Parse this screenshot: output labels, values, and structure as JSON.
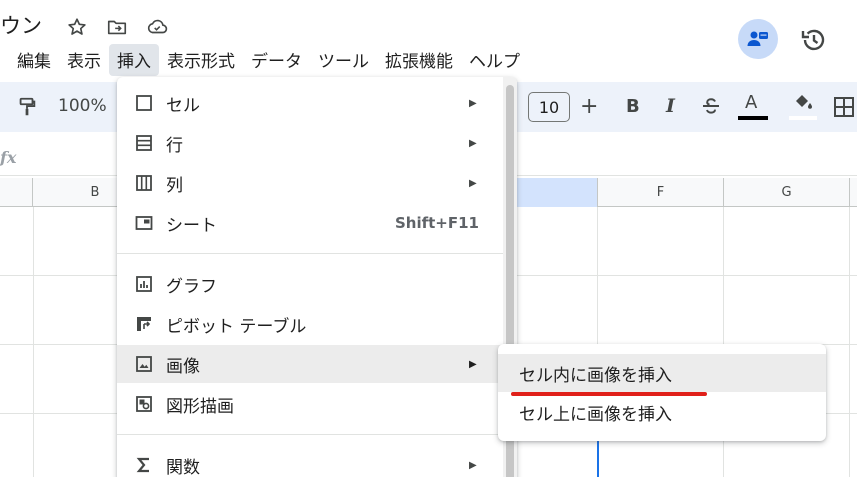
{
  "document": {
    "title": "ウン"
  },
  "menubar": {
    "items": [
      {
        "label": "編集"
      },
      {
        "label": "表示"
      },
      {
        "label": "挿入"
      },
      {
        "label": "表示形式"
      },
      {
        "label": "データ"
      },
      {
        "label": "ツール"
      },
      {
        "label": "拡張機能"
      },
      {
        "label": "ヘルプ"
      }
    ],
    "active_index": 2
  },
  "toolbar": {
    "zoom": "100%",
    "font_size": "10",
    "icons": [
      "paint-format-icon",
      "plus-icon",
      "bold-icon",
      "italic-icon",
      "strikethrough-icon",
      "text-color-icon",
      "fill-color-icon",
      "borders-icon"
    ],
    "bold_label": "B",
    "italic_label": "I",
    "text_color_label": "A",
    "text_color": "#000000",
    "fill_color": "#ffffff",
    "plus_label": "+"
  },
  "formula_bar": {
    "fx_label": "fx"
  },
  "grid": {
    "column_headers": [
      "B",
      "F",
      "G"
    ],
    "selected_column_color": "#d3e3fd"
  },
  "insert_menu": {
    "items": [
      {
        "label": "セル",
        "icon": "cell-icon",
        "has_submenu": true
      },
      {
        "label": "行",
        "icon": "rows-icon",
        "has_submenu": true
      },
      {
        "label": "列",
        "icon": "columns-icon",
        "has_submenu": true
      },
      {
        "label": "シート",
        "icon": "sheet-icon",
        "shortcut": "Shift+F11"
      },
      {
        "label": "グラフ",
        "icon": "chart-icon"
      },
      {
        "label": "ピボット テーブル",
        "icon": "pivot-table-icon"
      },
      {
        "label": "画像",
        "icon": "image-icon",
        "has_submenu": true,
        "highlighted": true
      },
      {
        "label": "図形描画",
        "icon": "drawing-icon"
      },
      {
        "label": "関数",
        "icon": "sigma-icon",
        "has_submenu": true
      }
    ],
    "submenu_arrow": "▶"
  },
  "image_submenu": {
    "items": [
      {
        "label": "セル内に画像を挿入",
        "highlighted": true
      },
      {
        "label": "セル上に画像を挿入"
      }
    ],
    "annotation_color": "#e0201a"
  }
}
